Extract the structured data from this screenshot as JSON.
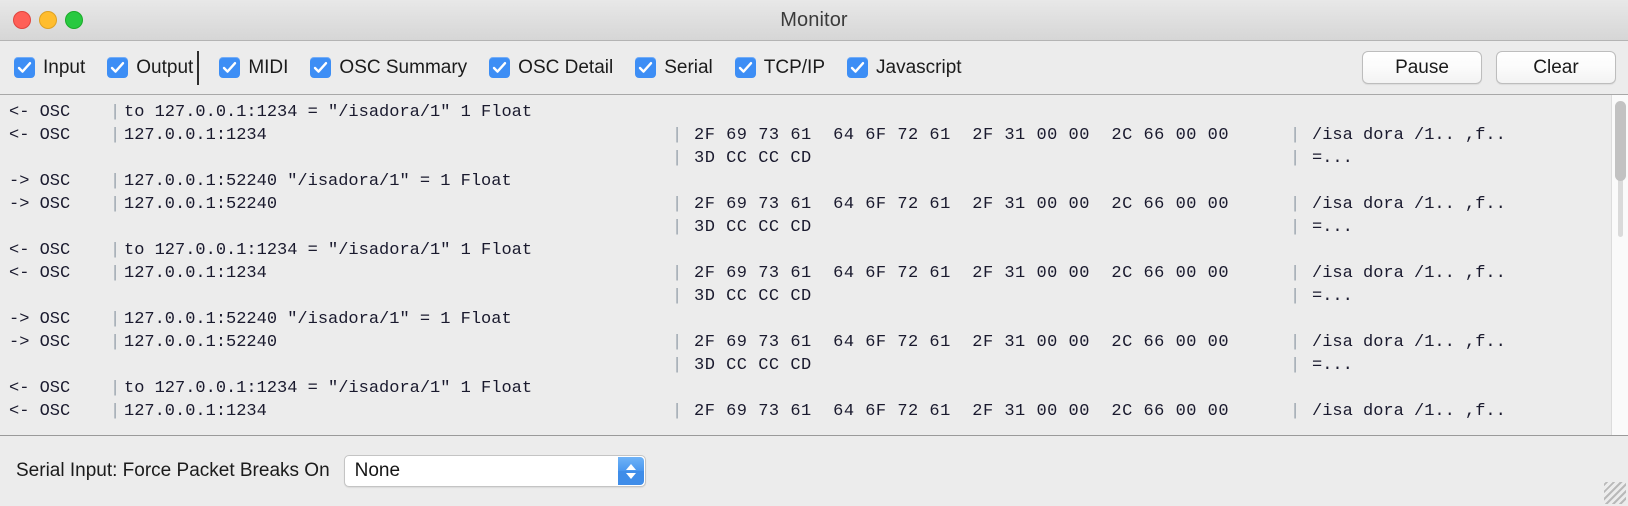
{
  "window": {
    "title": "Monitor",
    "traffic_lights": [
      "close",
      "minimize",
      "zoom"
    ]
  },
  "toolbar": {
    "checkboxes": [
      {
        "label": "Input",
        "checked": true
      },
      {
        "label": "Output",
        "checked": true
      },
      {
        "label": "MIDI",
        "checked": true
      },
      {
        "label": "OSC Summary",
        "checked": true
      },
      {
        "label": "OSC Detail",
        "checked": true
      },
      {
        "label": "Serial",
        "checked": true
      },
      {
        "label": "TCP/IP",
        "checked": true
      },
      {
        "label": "Javascript",
        "checked": true
      }
    ],
    "pause_label": "Pause",
    "clear_label": "Clear"
  },
  "log": {
    "lines": [
      {
        "dir": "<- OSC",
        "bar": "|",
        "msg": "to 127.0.0.1:1234 = \"/isadora/1\" 1 Float",
        "hex": "",
        "ascii": ""
      },
      {
        "dir": "<- OSC",
        "bar": "|",
        "msg": "127.0.0.1:1234",
        "hex": "2F 69 73 61  64 6F 72 61  2F 31 00 00  2C 66 00 00",
        "ascii": "/isa dora /1.. ,f.."
      },
      {
        "dir": "",
        "bar": "",
        "msg": "",
        "hex": "3D CC CC CD",
        "ascii": "=..."
      },
      {
        "dir": "-> OSC",
        "bar": "|",
        "msg": "127.0.0.1:52240 \"/isadora/1\" = 1 Float",
        "hex": "",
        "ascii": ""
      },
      {
        "dir": "-> OSC",
        "bar": "|",
        "msg": "127.0.0.1:52240",
        "hex": "2F 69 73 61  64 6F 72 61  2F 31 00 00  2C 66 00 00",
        "ascii": "/isa dora /1.. ,f.."
      },
      {
        "dir": "",
        "bar": "",
        "msg": "",
        "hex": "3D CC CC CD",
        "ascii": "=..."
      },
      {
        "dir": "<- OSC",
        "bar": "|",
        "msg": "to 127.0.0.1:1234 = \"/isadora/1\" 1 Float",
        "hex": "",
        "ascii": ""
      },
      {
        "dir": "<- OSC",
        "bar": "|",
        "msg": "127.0.0.1:1234",
        "hex": "2F 69 73 61  64 6F 72 61  2F 31 00 00  2C 66 00 00",
        "ascii": "/isa dora /1.. ,f.."
      },
      {
        "dir": "",
        "bar": "",
        "msg": "",
        "hex": "3D CC CC CD",
        "ascii": "=..."
      },
      {
        "dir": "-> OSC",
        "bar": "|",
        "msg": "127.0.0.1:52240 \"/isadora/1\" = 1 Float",
        "hex": "",
        "ascii": ""
      },
      {
        "dir": "-> OSC",
        "bar": "|",
        "msg": "127.0.0.1:52240",
        "hex": "2F 69 73 61  64 6F 72 61  2F 31 00 00  2C 66 00 00",
        "ascii": "/isa dora /1.. ,f.."
      },
      {
        "dir": "",
        "bar": "",
        "msg": "",
        "hex": "3D CC CC CD",
        "ascii": "=..."
      },
      {
        "dir": "<- OSC",
        "bar": "|",
        "msg": "to 127.0.0.1:1234 = \"/isadora/1\" 1 Float",
        "hex": "",
        "ascii": ""
      },
      {
        "dir": "<- OSC",
        "bar": "|",
        "msg": "127.0.0.1:1234",
        "hex": "2F 69 73 61  64 6F 72 61  2F 31 00 00  2C 66 00 00",
        "ascii": "/isa dora /1.. ,f.."
      }
    ]
  },
  "bottom": {
    "label": "Serial Input: Force Packet Breaks On",
    "popup_value": "None"
  },
  "colors": {
    "checkbox_blue": "#3d8ef5",
    "stepper_blue": "#3f8de9",
    "log_background": "#ececec",
    "log_text": "#1a1a2e"
  }
}
